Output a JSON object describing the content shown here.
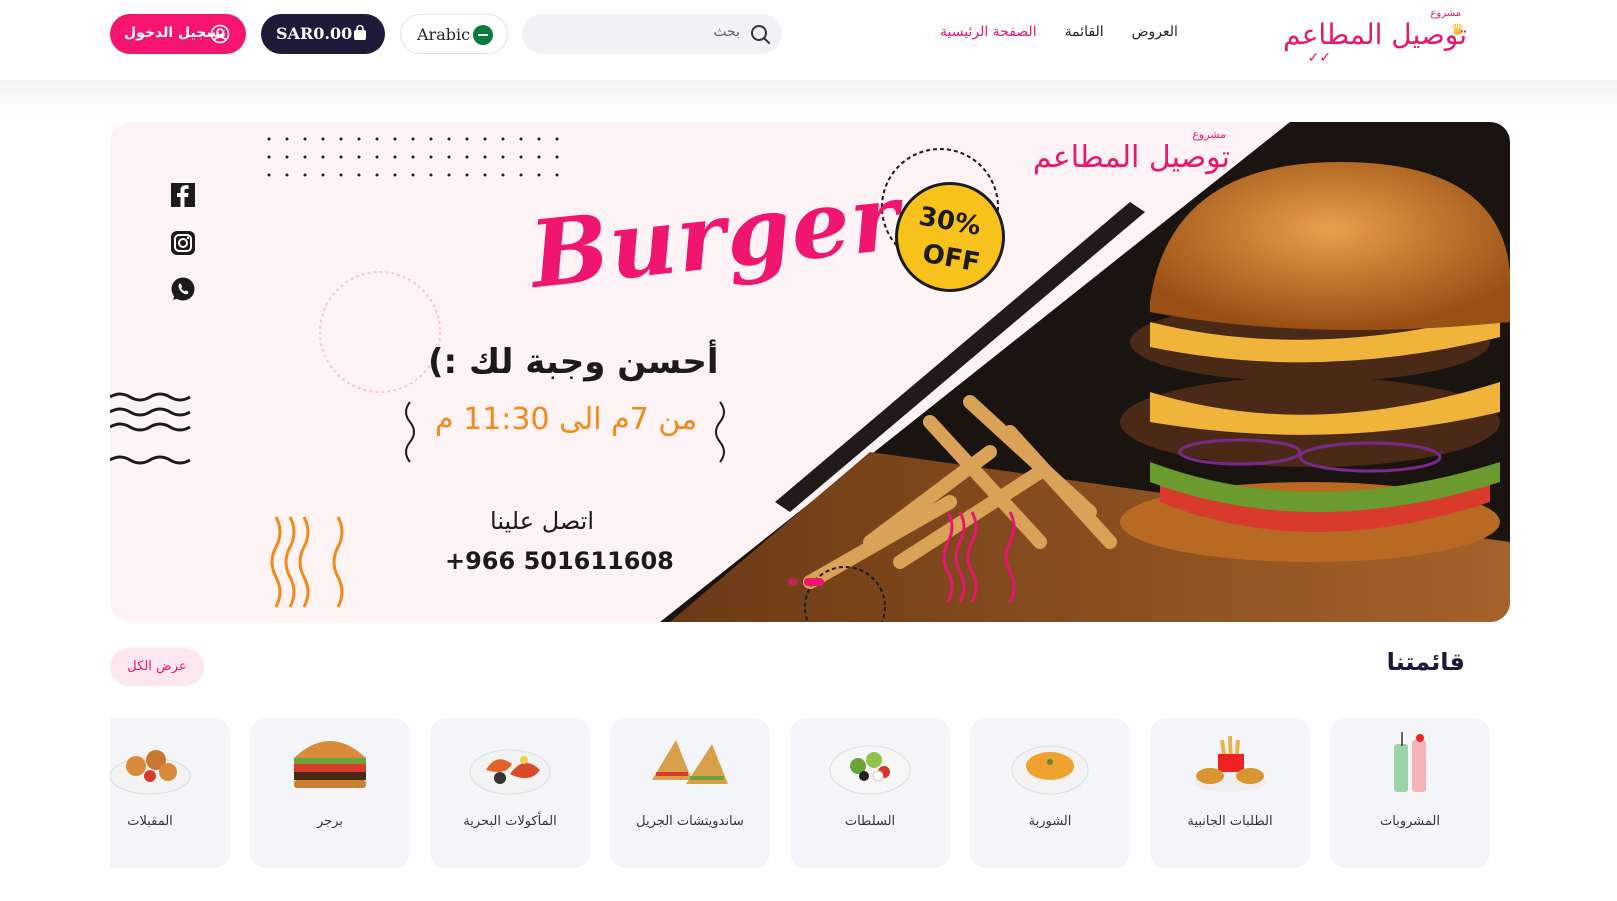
{
  "header": {
    "logo": {
      "small_text": "مشروع",
      "main_text": "توصيل المطاعم",
      "crown_icon": "crown-icon"
    },
    "nav": [
      {
        "label": "الصفحة الرئيسية",
        "active": true
      },
      {
        "label": "القائمة",
        "active": false
      },
      {
        "label": "العروض",
        "active": false
      }
    ],
    "search": {
      "placeholder": "بحث",
      "icon": "search-icon"
    },
    "language": {
      "label": "Arabic",
      "flag_icon": "saudi-flag-icon"
    },
    "cart": {
      "label": "SAR0.00",
      "icon": "shopping-bag-icon"
    },
    "login": {
      "label": "تسجيل الدخول",
      "icon": "user-circle-icon"
    }
  },
  "banner": {
    "logo": {
      "small_text": "مشروع",
      "main_text": "توصيل المطاعم"
    },
    "headline": "Burger",
    "discount": {
      "percent": "30%",
      "off": "OFF"
    },
    "tagline": "أحسن وجبة لك :)",
    "hours": "من 7م الى 11:30 م",
    "contact_label": "اتصل علينا",
    "phone": "+966 501611608",
    "social_icons": [
      "facebook-icon",
      "instagram-icon",
      "whatsapp-icon"
    ],
    "slider_active_index": 1,
    "slider_count": 2
  },
  "menu": {
    "title": "قائمتنا",
    "view_all": "عرض الكل",
    "categories": [
      {
        "label": "المشروبات",
        "icon": "drinks-image"
      },
      {
        "label": "الطلبات الجانبية",
        "icon": "sides-image"
      },
      {
        "label": "الشوربة",
        "icon": "soup-image"
      },
      {
        "label": "السلطات",
        "icon": "salad-image"
      },
      {
        "label": "ساندويتشات الجريل",
        "icon": "grill-sandwich-image"
      },
      {
        "label": "المأكولات البحرية",
        "icon": "seafood-image"
      },
      {
        "label": "برجر",
        "icon": "burger-image"
      },
      {
        "label": "المقبلات",
        "icon": "appetizers-image"
      }
    ]
  },
  "colors": {
    "brand": "#f0166f",
    "dark": "#1d1a3a",
    "accent_orange": "#f08a1a",
    "badge_yellow": "#f7c21b"
  }
}
